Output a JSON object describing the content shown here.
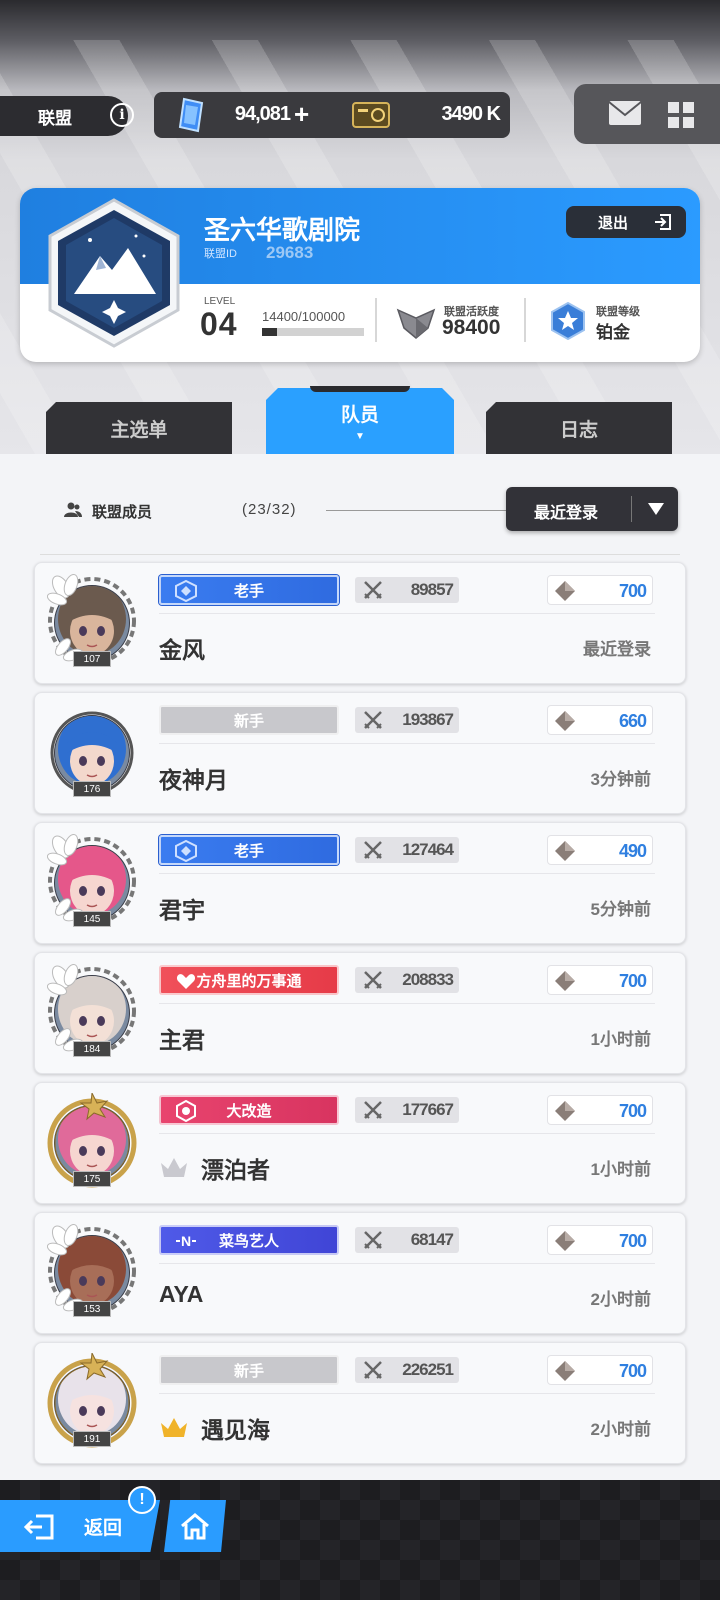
{
  "header": {
    "section_title": "联盟",
    "gems": "94,081",
    "credits": "3490 K"
  },
  "alliance": {
    "name": "圣六华歌剧院",
    "id_label": "联盟ID",
    "id": "29683",
    "quit_label": "退出",
    "level_label": "LEVEL",
    "level": "04",
    "exp_text": "14400/100000",
    "exp_progress": 0.144,
    "activity_label": "联盟活跃度",
    "activity": "98400",
    "rank_label": "联盟等级",
    "rank": "铂金"
  },
  "tabs": [
    {
      "label": "主选单",
      "active": false
    },
    {
      "label": "队员",
      "active": true
    },
    {
      "label": "日志",
      "active": false
    }
  ],
  "members_header": {
    "label": "联盟成员",
    "count": "(23/32)",
    "sort_label": "最近登录"
  },
  "members": [
    {
      "level": "107",
      "title": "老手",
      "title_style": "blue",
      "power": "89857",
      "contribution": "700",
      "name": "金风",
      "last_login": "最近登录",
      "crown": "none",
      "frame": "white-flower",
      "hair": "#6b5a4e",
      "skin": "#d9b59c"
    },
    {
      "level": "176",
      "title": "新手",
      "title_style": "gray",
      "power": "193867",
      "contribution": "660",
      "name": "夜神月",
      "last_login": "3分钟前",
      "crown": "none",
      "frame": "plain",
      "hair": "#2f6fd0",
      "skin": "#f3d8cc"
    },
    {
      "level": "145",
      "title": "老手",
      "title_style": "blue",
      "power": "127464",
      "contribution": "490",
      "name": "君宇",
      "last_login": "5分钟前",
      "crown": "none",
      "frame": "white-flower",
      "hair": "#e5578a",
      "skin": "#f6d6d0"
    },
    {
      "level": "184",
      "title": "方舟里的万事通",
      "title_style": "red",
      "power": "208833",
      "contribution": "700",
      "name": "主君",
      "last_login": "1小时前",
      "crown": "none",
      "frame": "white-flower",
      "hair": "#d8d0cc",
      "skin": "#f3e0d6"
    },
    {
      "level": "175",
      "title": "大改造",
      "title_style": "pink",
      "power": "177667",
      "contribution": "700",
      "name": "漂泊者",
      "last_login": "1小时前",
      "crown": "silver",
      "frame": "gold-star",
      "hair": "#e06a9a",
      "skin": "#f6d6d0"
    },
    {
      "level": "153",
      "title": "菜鸟艺人",
      "title_style": "indigo",
      "power": "68147",
      "contribution": "700",
      "name": "AYA",
      "last_login": "2小时前",
      "crown": "none",
      "frame": "white-flower",
      "hair": "#8a4a38",
      "skin": "#a86e58"
    },
    {
      "level": "191",
      "title": "新手",
      "title_style": "gray",
      "power": "226251",
      "contribution": "700",
      "name": "遇见海",
      "last_login": "2小时前",
      "crown": "gold",
      "frame": "gold-star",
      "hair": "#e8e2ea",
      "skin": "#f6e2e0"
    }
  ],
  "footer": {
    "back_label": "返回",
    "alert": "!"
  },
  "colors": {
    "accent": "#2a9cff",
    "title_blue": "#3a7cf0",
    "title_red": "#f0505a",
    "title_pink": "#e8446e",
    "title_indigo": "#4f5ae8",
    "contribution_text": "#2f7fe0"
  }
}
